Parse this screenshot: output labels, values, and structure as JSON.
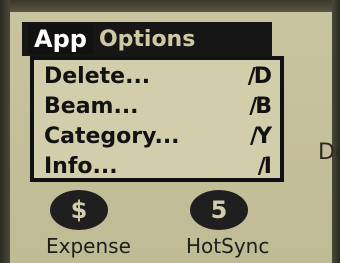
{
  "menubar": {
    "app": "App",
    "options": "Options"
  },
  "menu": [
    {
      "label": "Delete...",
      "shortcut": "∕D"
    },
    {
      "label": "Beam...",
      "shortcut": "∕B"
    },
    {
      "label": "Category...",
      "shortcut": "∕Y"
    },
    {
      "label": "Info...",
      "shortcut": "∕I"
    }
  ],
  "side_text": "Do",
  "apps": [
    {
      "label": "Expense",
      "icon": "expense-icon",
      "glyph": "$"
    },
    {
      "label": "HotSync",
      "icon": "hotsync-icon",
      "glyph": "5"
    }
  ]
}
